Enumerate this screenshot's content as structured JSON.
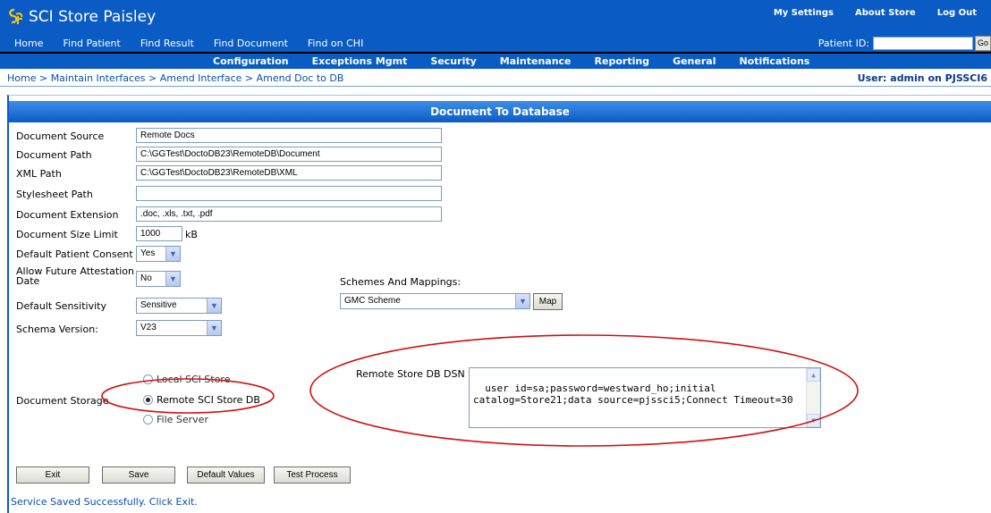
{
  "app": {
    "title": "SCI Store Paisley",
    "logo_icon": "sci-logo-icon"
  },
  "top_links": [
    "My Settings",
    "About Store",
    "Log Out"
  ],
  "nav_primary": [
    "Home",
    "Find Patient",
    "Find Result",
    "Find Document",
    "Find on CHI"
  ],
  "patient_id": {
    "label": "Patient ID:",
    "value": "",
    "go_label": "Go"
  },
  "nav_secondary": [
    "Configuration",
    "Exceptions Mgmt",
    "Security",
    "Maintenance",
    "Reporting",
    "General",
    "Notifications"
  ],
  "breadcrumb": "Home > Maintain Interfaces > Amend Interface > Amend Doc to DB",
  "user_info": "User: admin on PJSSCI6",
  "section_title": "Document To Database",
  "form": {
    "document_source": {
      "label": "Document Source",
      "value": "Remote Docs"
    },
    "document_path": {
      "label": "Document Path",
      "value": "C:\\GGTest\\DoctoDB23\\RemoteDB\\Document"
    },
    "xml_path": {
      "label": "XML Path",
      "value": "C:\\GGTest\\DoctoDB23\\RemoteDB\\XML"
    },
    "stylesheet_path": {
      "label": "Stylesheet Path",
      "value": ""
    },
    "document_extension": {
      "label": "Document Extension",
      "value": ".doc, .xls, .txt, .pdf"
    },
    "document_size_limit": {
      "label": "Document Size Limit",
      "value": "1000",
      "unit": "kB"
    },
    "default_patient_consent": {
      "label": "Default Patient Consent",
      "value": "Yes"
    },
    "allow_future_attestation": {
      "label_line1": "Allow Future Attestation",
      "label_line2": "Date",
      "value": "No"
    },
    "default_sensitivity": {
      "label": "Default Sensitivity",
      "value": "Sensitive"
    },
    "schema_version": {
      "label": "Schema Version:",
      "value": "V23"
    },
    "schemes": {
      "label": "Schemes And Mappings:",
      "value": "GMC Scheme",
      "map_label": "Map"
    },
    "document_storage": {
      "label": "Document Storage",
      "options": [
        "Local SCI Store",
        "Remote SCI Store DB",
        "File Server"
      ],
      "selected": "Remote SCI Store DB"
    },
    "remote_dsn": {
      "label": "Remote Store DB DSN",
      "value": "user id=sa;password=westward_ho;initial catalog=Store21;data source=pjssci5;Connect Timeout=30"
    }
  },
  "buttons": {
    "exit": "Exit",
    "save": "Save",
    "default_values": "Default Values",
    "test_process": "Test Process"
  },
  "status_message": "Service Saved Successfully. Click Exit.",
  "colors": {
    "nav_blue": "#0a5cc4",
    "link_blue": "#0a4fb0",
    "annotation_red": "#d01010",
    "logo_yellow": "#f5c518"
  }
}
